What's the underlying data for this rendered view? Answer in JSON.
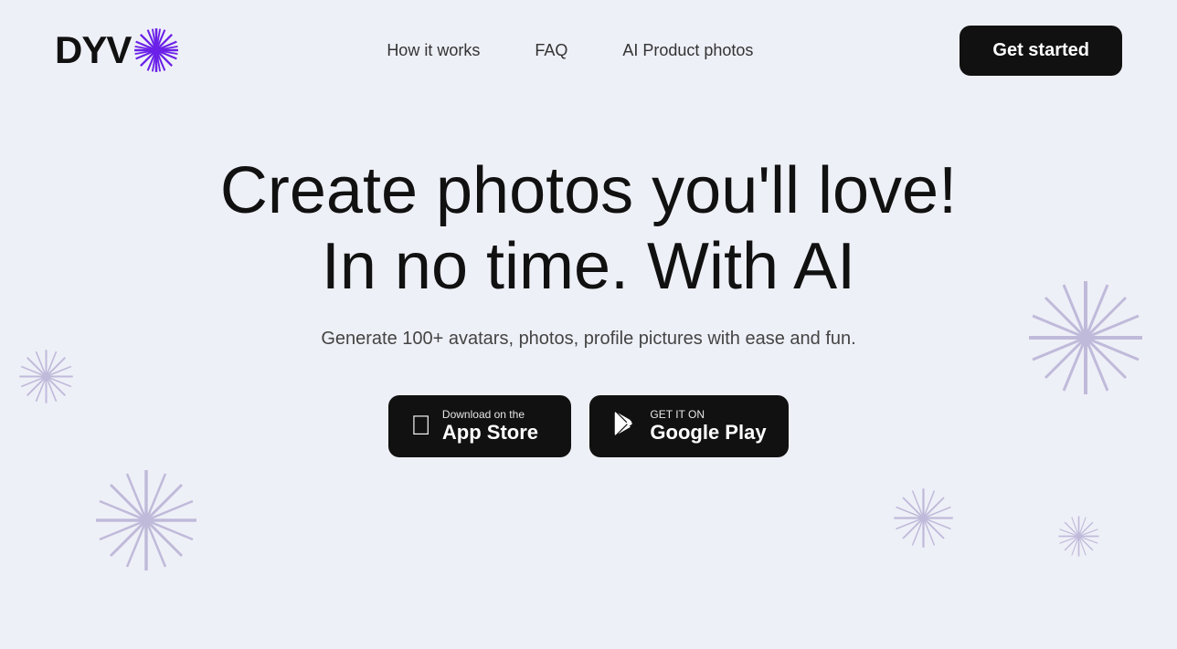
{
  "navbar": {
    "logo_text": "DYV",
    "nav_links": [
      {
        "label": "How it works",
        "id": "how-it-works"
      },
      {
        "label": "FAQ",
        "id": "faq"
      },
      {
        "label": "AI Product photos",
        "id": "ai-product-photos"
      }
    ],
    "cta_label": "Get started"
  },
  "hero": {
    "title_line1": "Create photos you'll love!",
    "title_line2": "In no time. With AI",
    "subtitle": "Generate 100+ avatars, photos, profile pictures with ease and fun.",
    "app_store_label_small": "Download on the",
    "app_store_label_large": "App Store",
    "google_play_label_small": "GET IT ON",
    "google_play_label_large": "Google Play"
  },
  "decorative": {
    "accent_color": "#6b46c1",
    "light_accent": "#a89ccf"
  }
}
